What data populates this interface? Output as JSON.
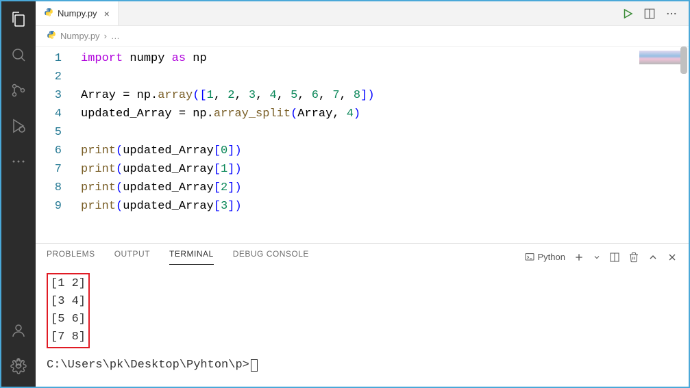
{
  "tab": {
    "filename": "Numpy.py",
    "closeSymbol": "×"
  },
  "breadcrumb": {
    "filename": "Numpy.py",
    "chevron": "›",
    "more": "…"
  },
  "editor": {
    "lines": [
      {
        "n": "1",
        "tokens": [
          {
            "t": "import",
            "c": "kw-purple"
          },
          {
            "t": " numpy ",
            "c": ""
          },
          {
            "t": "as",
            "c": "kw-purple"
          },
          {
            "t": " np",
            "c": ""
          }
        ]
      },
      {
        "n": "2",
        "tokens": []
      },
      {
        "n": "3",
        "tokens": [
          {
            "t": "Array ",
            "c": ""
          },
          {
            "t": "=",
            "c": ""
          },
          {
            "t": " np",
            "c": ""
          },
          {
            "t": ".",
            "c": ""
          },
          {
            "t": "array",
            "c": "fn-yellow"
          },
          {
            "t": "([",
            "c": "kw-blue"
          },
          {
            "t": "1",
            "c": "num-green"
          },
          {
            "t": ", ",
            "c": ""
          },
          {
            "t": "2",
            "c": "num-green"
          },
          {
            "t": ", ",
            "c": ""
          },
          {
            "t": "3",
            "c": "num-green"
          },
          {
            "t": ", ",
            "c": ""
          },
          {
            "t": "4",
            "c": "num-green"
          },
          {
            "t": ", ",
            "c": ""
          },
          {
            "t": "5",
            "c": "num-green"
          },
          {
            "t": ", ",
            "c": ""
          },
          {
            "t": "6",
            "c": "num-green"
          },
          {
            "t": ", ",
            "c": ""
          },
          {
            "t": "7",
            "c": "num-green"
          },
          {
            "t": ", ",
            "c": ""
          },
          {
            "t": "8",
            "c": "num-green"
          },
          {
            "t": "])",
            "c": "kw-blue"
          }
        ]
      },
      {
        "n": "4",
        "tokens": [
          {
            "t": "updated_Array ",
            "c": ""
          },
          {
            "t": "=",
            "c": ""
          },
          {
            "t": " np",
            "c": ""
          },
          {
            "t": ".",
            "c": ""
          },
          {
            "t": "array_split",
            "c": "fn-yellow"
          },
          {
            "t": "(",
            "c": "kw-blue"
          },
          {
            "t": "Array",
            "c": ""
          },
          {
            "t": ", ",
            "c": ""
          },
          {
            "t": "4",
            "c": "num-green"
          },
          {
            "t": ")",
            "c": "kw-blue"
          }
        ]
      },
      {
        "n": "5",
        "tokens": []
      },
      {
        "n": "6",
        "tokens": [
          {
            "t": "print",
            "c": "fn-yellow"
          },
          {
            "t": "(",
            "c": "kw-blue"
          },
          {
            "t": "updated_Array",
            "c": ""
          },
          {
            "t": "[",
            "c": "kw-blue"
          },
          {
            "t": "0",
            "c": "num-green"
          },
          {
            "t": "])",
            "c": "kw-blue"
          }
        ]
      },
      {
        "n": "7",
        "tokens": [
          {
            "t": "print",
            "c": "fn-yellow"
          },
          {
            "t": "(",
            "c": "kw-blue"
          },
          {
            "t": "updated_Array",
            "c": ""
          },
          {
            "t": "[",
            "c": "kw-blue"
          },
          {
            "t": "1",
            "c": "num-green"
          },
          {
            "t": "])",
            "c": "kw-blue"
          }
        ]
      },
      {
        "n": "8",
        "tokens": [
          {
            "t": "print",
            "c": "fn-yellow"
          },
          {
            "t": "(",
            "c": "kw-blue"
          },
          {
            "t": "updated_Array",
            "c": ""
          },
          {
            "t": "[",
            "c": "kw-blue"
          },
          {
            "t": "2",
            "c": "num-green"
          },
          {
            "t": "])",
            "c": "kw-blue"
          }
        ]
      },
      {
        "n": "9",
        "tokens": [
          {
            "t": "print",
            "c": "fn-yellow"
          },
          {
            "t": "(",
            "c": "kw-blue"
          },
          {
            "t": "updated_Array",
            "c": ""
          },
          {
            "t": "[",
            "c": "kw-blue"
          },
          {
            "t": "3",
            "c": "num-green"
          },
          {
            "t": "])",
            "c": "kw-blue"
          }
        ]
      }
    ]
  },
  "panel": {
    "tabs": {
      "problems": "PROBLEMS",
      "output": "OUTPUT",
      "terminal": "TERMINAL",
      "debugConsole": "DEBUG CONSOLE"
    },
    "terminalType": "Python"
  },
  "terminal": {
    "output": [
      "[1 2]",
      "[3 4]",
      "[5 6]",
      "[7 8]"
    ],
    "prompt": "C:\\Users\\pk\\Desktop\\Pyhton\\p>"
  }
}
